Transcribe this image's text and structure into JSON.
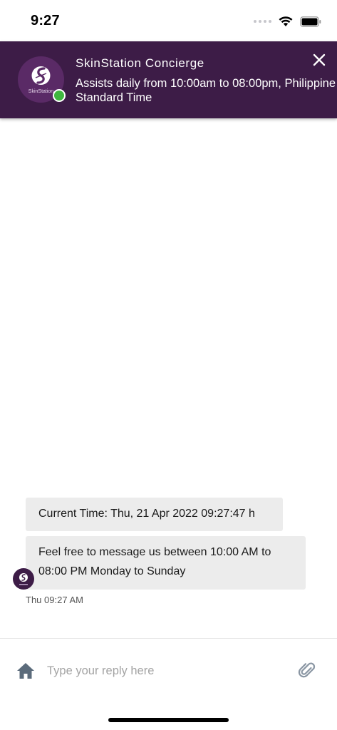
{
  "status_bar": {
    "time": "9:27",
    "icons": [
      "signal-dots-icon",
      "wifi-icon",
      "battery-icon"
    ]
  },
  "header": {
    "avatar_icon": "skinstation-logo-icon",
    "avatar_text": "SkinStation",
    "title": "SkinStation Concierge",
    "subtitle": "Assists daily from 10:00am to 08:00pm, Philippine Standard Time",
    "status_color": "#3fb63f",
    "close_icon": "close-icon"
  },
  "messages": [
    {
      "text": "Current Time: Thu, 21 Apr 2022 09:27:47 h"
    },
    {
      "text": "Feel free to message us between 10:00 AM to 08:00 PM Monday to Sunday"
    }
  ],
  "message_timestamp": "Thu 09:27 AM",
  "composer": {
    "home_icon": "home-icon",
    "placeholder": "Type your reply here",
    "value": "",
    "attach_icon": "paperclip-icon"
  },
  "colors": {
    "header_bg": "#3d1c47",
    "bubble_bg": "#ececec",
    "icon_gray": "#5b6b7b"
  }
}
